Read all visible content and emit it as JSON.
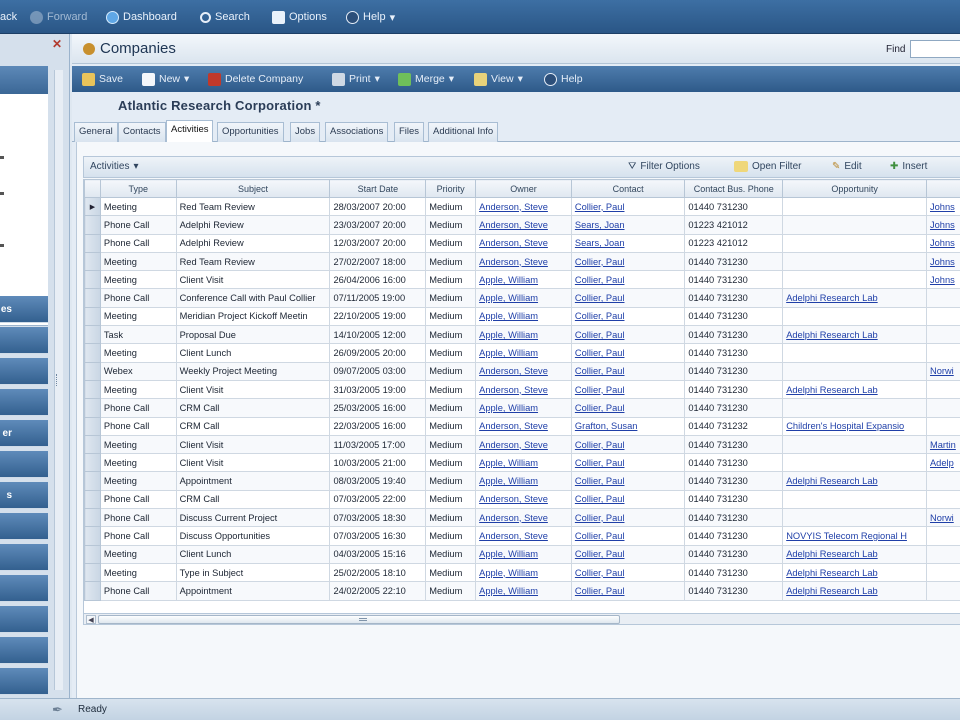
{
  "topbar": {
    "items": [
      {
        "label": "ack",
        "icon": "back-icon"
      },
      {
        "label": "Forward",
        "icon": "forward-icon"
      },
      {
        "label": "Dashboard",
        "icon": "dashboard-icon"
      },
      {
        "label": "Search",
        "icon": "search-icon"
      },
      {
        "label": "Options",
        "icon": "options-icon"
      },
      {
        "label": "Help",
        "icon": "help-icon"
      }
    ]
  },
  "sidebar": {
    "close": "✕",
    "buttons": [
      "es",
      "",
      "",
      "",
      "er",
      "",
      "s",
      "",
      "",
      "",
      "",
      "",
      ""
    ]
  },
  "header": {
    "title": "Companies",
    "find_label": "Find",
    "find_value": ""
  },
  "toolbar": {
    "save": "Save",
    "new": "New",
    "delete": "Delete Company",
    "print": "Print",
    "merge": "Merge",
    "view": "View",
    "help": "Help"
  },
  "company_name": "Atlantic Research Corporation *",
  "tabs": [
    "General",
    "Contacts",
    "Activities",
    "Opportunities",
    "Jobs",
    "Associations",
    "Files",
    "Additional Info"
  ],
  "active_tab": "Activities",
  "gridbar": {
    "activities": "Activities",
    "filter_options": "Filter Options",
    "open_filter": "Open Filter",
    "edit": "Edit",
    "insert": "Insert"
  },
  "columns": [
    "Type",
    "Subject",
    "Start Date",
    "Priority",
    "Owner",
    "Contact",
    "Contact Bus. Phone",
    "Opportunity",
    ""
  ],
  "rows": [
    [
      "Meeting",
      "Red Team Review",
      "28/03/2007 20:00",
      "Medium",
      "Anderson, Steve",
      "Collier, Paul",
      "01440 731230",
      "",
      "Johns"
    ],
    [
      "Phone Call",
      "Adelphi Review",
      "23/03/2007 20:00",
      "Medium",
      "Anderson, Steve",
      "Sears, Joan",
      "01223 421012",
      "",
      "Johns"
    ],
    [
      "Phone Call",
      "Adelphi Review",
      "12/03/2007 20:00",
      "Medium",
      "Anderson, Steve",
      "Sears, Joan",
      "01223 421012",
      "",
      "Johns"
    ],
    [
      "Meeting",
      "Red Team Review",
      "27/02/2007 18:00",
      "Medium",
      "Anderson, Steve",
      "Collier, Paul",
      "01440 731230",
      "",
      "Johns"
    ],
    [
      "Meeting",
      "Client Visit",
      "26/04/2006 16:00",
      "Medium",
      "Apple, William",
      "Collier, Paul",
      "01440 731230",
      "",
      "Johns"
    ],
    [
      "Phone Call",
      "Conference Call with Paul Collier",
      "07/11/2005 19:00",
      "Medium",
      "Apple, William",
      "Collier, Paul",
      "01440 731230",
      "Adelphi Research Lab",
      ""
    ],
    [
      "Meeting",
      "Meridian Project Kickoff Meetin",
      "22/10/2005 19:00",
      "Medium",
      "Apple, William",
      "Collier, Paul",
      "01440 731230",
      "",
      ""
    ],
    [
      "Task",
      "Proposal Due",
      "14/10/2005 12:00",
      "Medium",
      "Apple, William",
      "Collier, Paul",
      "01440 731230",
      "Adelphi Research Lab",
      ""
    ],
    [
      "Meeting",
      "Client Lunch",
      "26/09/2005 20:00",
      "Medium",
      "Apple, William",
      "Collier, Paul",
      "01440 731230",
      "",
      ""
    ],
    [
      "Webex",
      "Weekly Project Meeting",
      "09/07/2005 03:00",
      "Medium",
      "Anderson, Steve",
      "Collier, Paul",
      "01440 731230",
      "",
      "Norwi"
    ],
    [
      "Meeting",
      "Client Visit",
      "31/03/2005 19:00",
      "Medium",
      "Anderson, Steve",
      "Collier, Paul",
      "01440 731230",
      "Adelphi Research Lab",
      ""
    ],
    [
      "Phone Call",
      "CRM Call",
      "25/03/2005 16:00",
      "Medium",
      "Apple, William",
      "Collier, Paul",
      "01440 731230",
      "",
      ""
    ],
    [
      "Phone Call",
      "CRM Call",
      "22/03/2005 16:00",
      "Medium",
      "Anderson, Steve",
      "Grafton, Susan",
      "01440 731232",
      "Children's Hospital Expansio",
      ""
    ],
    [
      "Meeting",
      "Client Visit",
      "11/03/2005 17:00",
      "Medium",
      "Anderson, Steve",
      "Collier, Paul",
      "01440 731230",
      "",
      "Martin"
    ],
    [
      "Meeting",
      "Client Visit",
      "10/03/2005 21:00",
      "Medium",
      "Apple, William",
      "Collier, Paul",
      "01440 731230",
      "",
      "Adelp"
    ],
    [
      "Meeting",
      "Appointment",
      "08/03/2005 19:40",
      "Medium",
      "Apple, William",
      "Collier, Paul",
      "01440 731230",
      "Adelphi Research Lab",
      ""
    ],
    [
      "Phone Call",
      "CRM Call",
      "07/03/2005 22:00",
      "Medium",
      "Anderson, Steve",
      "Collier, Paul",
      "01440 731230",
      "",
      ""
    ],
    [
      "Phone Call",
      "Discuss Current Project",
      "07/03/2005 18:30",
      "Medium",
      "Anderson, Steve",
      "Collier, Paul",
      "01440 731230",
      "",
      "Norwi"
    ],
    [
      "Phone Call",
      "Discuss Opportunities",
      "07/03/2005 16:30",
      "Medium",
      "Anderson, Steve",
      "Collier, Paul",
      "01440 731230",
      "NOVYIS Telecom Regional H",
      ""
    ],
    [
      "Meeting",
      "Client Lunch",
      "04/03/2005 15:16",
      "Medium",
      "Apple, William",
      "Collier, Paul",
      "01440 731230",
      "Adelphi Research Lab",
      ""
    ],
    [
      "Meeting",
      "Type in Subject",
      "25/02/2005 18:10",
      "Medium",
      "Apple, William",
      "Collier, Paul",
      "01440 731230",
      "Adelphi Research Lab",
      ""
    ],
    [
      "Phone Call",
      "Appointment",
      "24/02/2005 22:10",
      "Medium",
      "Apple, William",
      "Collier, Paul",
      "01440 731230",
      "Adelphi Research Lab",
      ""
    ]
  ],
  "status": "Ready",
  "colors": {
    "toolbar": "#2e5a89",
    "link": "#1f3fa8",
    "accent": "#c8902e"
  }
}
